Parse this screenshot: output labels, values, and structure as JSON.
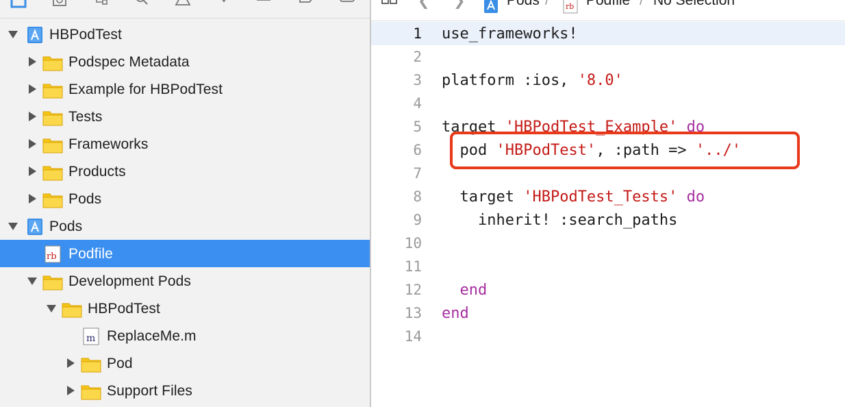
{
  "colors": {
    "selection": "#3b8ff0",
    "keyword": "#a62ea0",
    "string": "#c41a16",
    "annotation": "#e8391b",
    "folder": "#f5c518"
  },
  "navigator": {
    "toolbar_icons": [
      "project-navigator-icon",
      "source-control-icon",
      "symbol-navigator-icon",
      "find-icon",
      "issue-icon",
      "test-icon",
      "debug-icon",
      "breakpoint-icon",
      "report-icon"
    ],
    "tree": [
      {
        "label": "HBPodTest",
        "icon": "project-icon",
        "indent": 0,
        "disclosure": "open"
      },
      {
        "label": "Podspec Metadata",
        "icon": "folder-icon",
        "indent": 1,
        "disclosure": "closed"
      },
      {
        "label": "Example for HBPodTest",
        "icon": "folder-icon",
        "indent": 1,
        "disclosure": "closed"
      },
      {
        "label": "Tests",
        "icon": "folder-icon",
        "indent": 1,
        "disclosure": "closed"
      },
      {
        "label": "Frameworks",
        "icon": "folder-icon",
        "indent": 1,
        "disclosure": "closed"
      },
      {
        "label": "Products",
        "icon": "folder-icon",
        "indent": 1,
        "disclosure": "closed"
      },
      {
        "label": "Pods",
        "icon": "folder-icon",
        "indent": 1,
        "disclosure": "closed"
      },
      {
        "label": "Pods",
        "icon": "project-icon",
        "indent": 0,
        "disclosure": "open"
      },
      {
        "label": "Podfile",
        "icon": "ruby-file-icon",
        "indent": 1,
        "disclosure": "none",
        "selected": true
      },
      {
        "label": "Development Pods",
        "icon": "folder-icon",
        "indent": 1,
        "disclosure": "open"
      },
      {
        "label": "HBPodTest",
        "icon": "folder-icon",
        "indent": 2,
        "disclosure": "open"
      },
      {
        "label": "ReplaceMe.m",
        "icon": "objc-file-icon",
        "indent": 3,
        "disclosure": "none"
      },
      {
        "label": "Pod",
        "icon": "folder-icon",
        "indent": 3,
        "disclosure": "closed"
      },
      {
        "label": "Support Files",
        "icon": "folder-icon",
        "indent": 3,
        "disclosure": "closed"
      }
    ]
  },
  "jumpbar": {
    "path": [
      "Pods",
      "Podfile",
      "No Selection"
    ],
    "separator": "/",
    "file_badge": "rb"
  },
  "editor": {
    "current_line": 1,
    "lines": [
      {
        "n": "1",
        "tokens": [
          {
            "t": "use_frameworks!",
            "k": "plain"
          }
        ]
      },
      {
        "n": "2",
        "tokens": []
      },
      {
        "n": "3",
        "tokens": [
          {
            "t": "platform :ios, ",
            "k": "plain"
          },
          {
            "t": "'8.0'",
            "k": "string"
          }
        ]
      },
      {
        "n": "4",
        "tokens": []
      },
      {
        "n": "5",
        "tokens": [
          {
            "t": "target ",
            "k": "plain"
          },
          {
            "t": "'HBPodTest_Example'",
            "k": "string"
          },
          {
            "t": " ",
            "k": "plain"
          },
          {
            "t": "do",
            "k": "keyword"
          }
        ]
      },
      {
        "n": "6",
        "tokens": [
          {
            "t": "  pod ",
            "k": "plain"
          },
          {
            "t": "'HBPodTest'",
            "k": "string"
          },
          {
            "t": ", :path => ",
            "k": "plain"
          },
          {
            "t": "'../'",
            "k": "string"
          }
        ]
      },
      {
        "n": "7",
        "tokens": []
      },
      {
        "n": "8",
        "tokens": [
          {
            "t": "  target ",
            "k": "plain"
          },
          {
            "t": "'HBPodTest_Tests'",
            "k": "string"
          },
          {
            "t": " ",
            "k": "plain"
          },
          {
            "t": "do",
            "k": "keyword"
          }
        ]
      },
      {
        "n": "9",
        "tokens": [
          {
            "t": "    inherit! :search_paths",
            "k": "plain"
          }
        ]
      },
      {
        "n": "10",
        "tokens": []
      },
      {
        "n": "11",
        "tokens": []
      },
      {
        "n": "12",
        "tokens": [
          {
            "t": "  ",
            "k": "plain"
          },
          {
            "t": "end",
            "k": "keyword"
          }
        ]
      },
      {
        "n": "13",
        "tokens": [
          {
            "t": "end",
            "k": "keyword"
          }
        ]
      },
      {
        "n": "14",
        "tokens": []
      }
    ]
  }
}
